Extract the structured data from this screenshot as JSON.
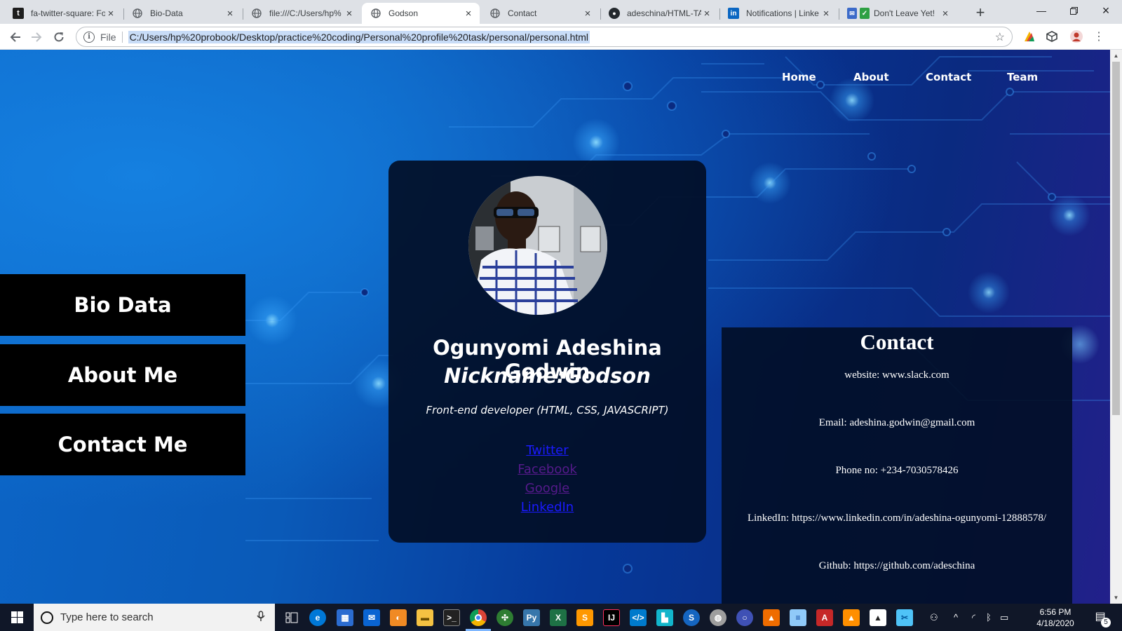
{
  "browser": {
    "tabs": [
      {
        "title": "fa-twitter-square: Fo",
        "icon": "twitter-square-icon",
        "active": false
      },
      {
        "title": "Bio-Data",
        "icon": "globe-icon",
        "active": false
      },
      {
        "title": "file:///C:/Users/hp%",
        "icon": "globe-icon",
        "active": false
      },
      {
        "title": "Godson",
        "icon": "globe-icon",
        "active": true
      },
      {
        "title": "Contact",
        "icon": "globe-icon",
        "active": false
      },
      {
        "title": "adeschina/HTML-TA",
        "icon": "github-icon",
        "active": false
      },
      {
        "title": "Notifications | Linke",
        "icon": "linkedin-icon",
        "active": false
      },
      {
        "title": "Don't Leave Yet!",
        "icon": "checkbox-icon",
        "active": false
      }
    ],
    "address_scheme": "File",
    "address_url": "C:/Users/hp%20probook/Desktop/practice%20coding/Personal%20profile%20task/personal/personal.html"
  },
  "page": {
    "topnav": [
      "Home",
      "About",
      "Contact",
      "Team"
    ],
    "side_menu": [
      "Bio Data",
      "About Me",
      "Contact Me"
    ],
    "profile": {
      "name": "Ogunyomi Adeshina Godwin",
      "nickname": "Nickname:Godson",
      "role": "Front-end developer (HTML, CSS, JAVASCRIPT)",
      "links": [
        {
          "label": "Twitter",
          "visited": false
        },
        {
          "label": "Facebook",
          "visited": true
        },
        {
          "label": "Google",
          "visited": true
        },
        {
          "label": "LinkedIn",
          "visited": false
        }
      ]
    },
    "contact": {
      "heading": "Contact",
      "rows": [
        "website: www.slack.com",
        "Email: adeshina.godwin@gmail.com",
        "Phone no: +234-7030578426",
        "LinkedIn: https://www.linkedin.com/in/adeshina-ogunyomi-12888578/",
        "Github: https://github.com/adeschina"
      ]
    }
  },
  "taskbar": {
    "search_placeholder": "Type here to search",
    "time": "6:56 PM",
    "date": "4/18/2020",
    "notification_count": "5"
  },
  "colors": {
    "page_bg": "#0a5ab8",
    "card_bg": "#020e26",
    "side_menu_bg": "#000000",
    "link_unvisited": "#1a1aff",
    "link_visited": "#551a8b",
    "taskbar_bg": "#101728"
  }
}
